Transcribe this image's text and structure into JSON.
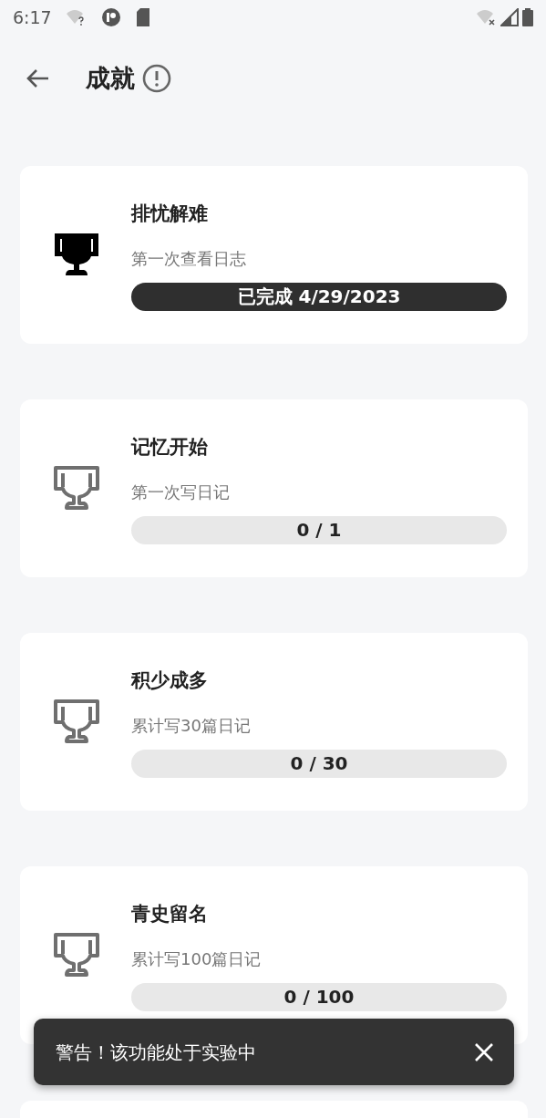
{
  "status_bar": {
    "time": "6:17"
  },
  "header": {
    "title": "成就"
  },
  "achievements": [
    {
      "title": "排忧解难",
      "description": "第一次查看日志",
      "progress": "已完成 4/29/2023",
      "completed": true
    },
    {
      "title": "记忆开始",
      "description": "第一次写日记",
      "progress": "0 / 1",
      "completed": false
    },
    {
      "title": "积少成多",
      "description": "累计写30篇日记",
      "progress": "0 / 30",
      "completed": false
    },
    {
      "title": "青史留名",
      "description": "累计写100篇日记",
      "progress": "0 / 100",
      "completed": false
    }
  ],
  "snackbar": {
    "message": "警告！该功能处于实验中"
  }
}
